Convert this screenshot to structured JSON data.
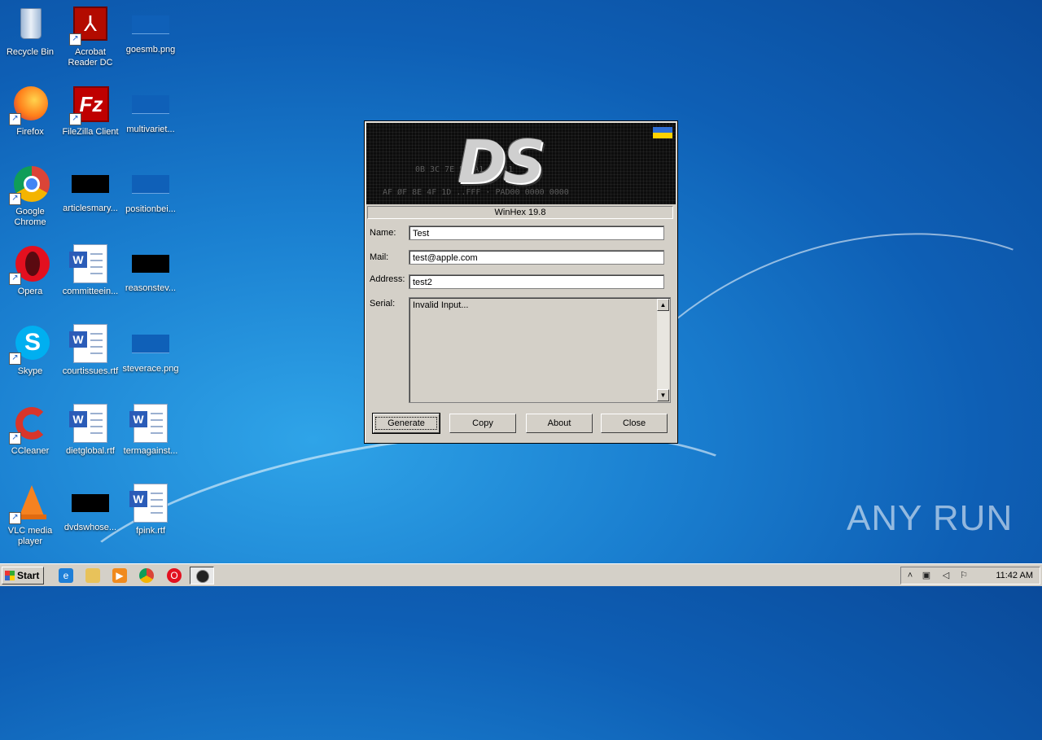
{
  "desktop": {
    "icons": [
      {
        "label": "Recycle Bin",
        "icon": "recycle-bin-icon"
      },
      {
        "label": "Acrobat Reader DC",
        "icon": "acrobat-icon"
      },
      {
        "label": "goesmb.png",
        "icon": "image-file-icon"
      },
      {
        "label": "Firefox",
        "icon": "firefox-icon"
      },
      {
        "label": "FileZilla Client",
        "icon": "filezilla-icon"
      },
      {
        "label": "multivariet...",
        "icon": "image-file-icon"
      },
      {
        "label": "Google Chrome",
        "icon": "chrome-icon"
      },
      {
        "label": "articlesmary...",
        "icon": "image-file-icon"
      },
      {
        "label": "positionbei...",
        "icon": "image-file-icon"
      },
      {
        "label": "Opera",
        "icon": "opera-icon"
      },
      {
        "label": "committeein...",
        "icon": "word-document-icon"
      },
      {
        "label": "reasonstev...",
        "icon": "image-file-icon"
      },
      {
        "label": "Skype",
        "icon": "skype-icon"
      },
      {
        "label": "courtissues.rtf",
        "icon": "word-document-icon"
      },
      {
        "label": "steverace.png",
        "icon": "image-file-icon"
      },
      {
        "label": "CCleaner",
        "icon": "ccleaner-icon"
      },
      {
        "label": "dietglobal.rtf",
        "icon": "word-document-icon"
      },
      {
        "label": "termagainst...",
        "icon": "word-document-icon"
      },
      {
        "label": "VLC media player",
        "icon": "vlc-icon"
      },
      {
        "label": "dvdswhose...",
        "icon": "image-file-icon"
      },
      {
        "label": "fpink.rtf",
        "icon": "word-document-icon"
      }
    ]
  },
  "dialog": {
    "banner_text": "DS",
    "version": "WinHex 19.8",
    "name_label": "Name:",
    "name_value": "Test",
    "mail_label": "Mail:",
    "mail_value": "test@apple.com",
    "address_label": "Address:",
    "address_value": "test2",
    "serial_label": "Serial:",
    "serial_value": "Invalid Input...",
    "buttons": {
      "generate": "Generate",
      "copy": "Copy",
      "about": "About",
      "close": "Close"
    }
  },
  "taskbar": {
    "start_label": "Start",
    "clock": "11:42 AM"
  },
  "watermark": "ANY RUN"
}
